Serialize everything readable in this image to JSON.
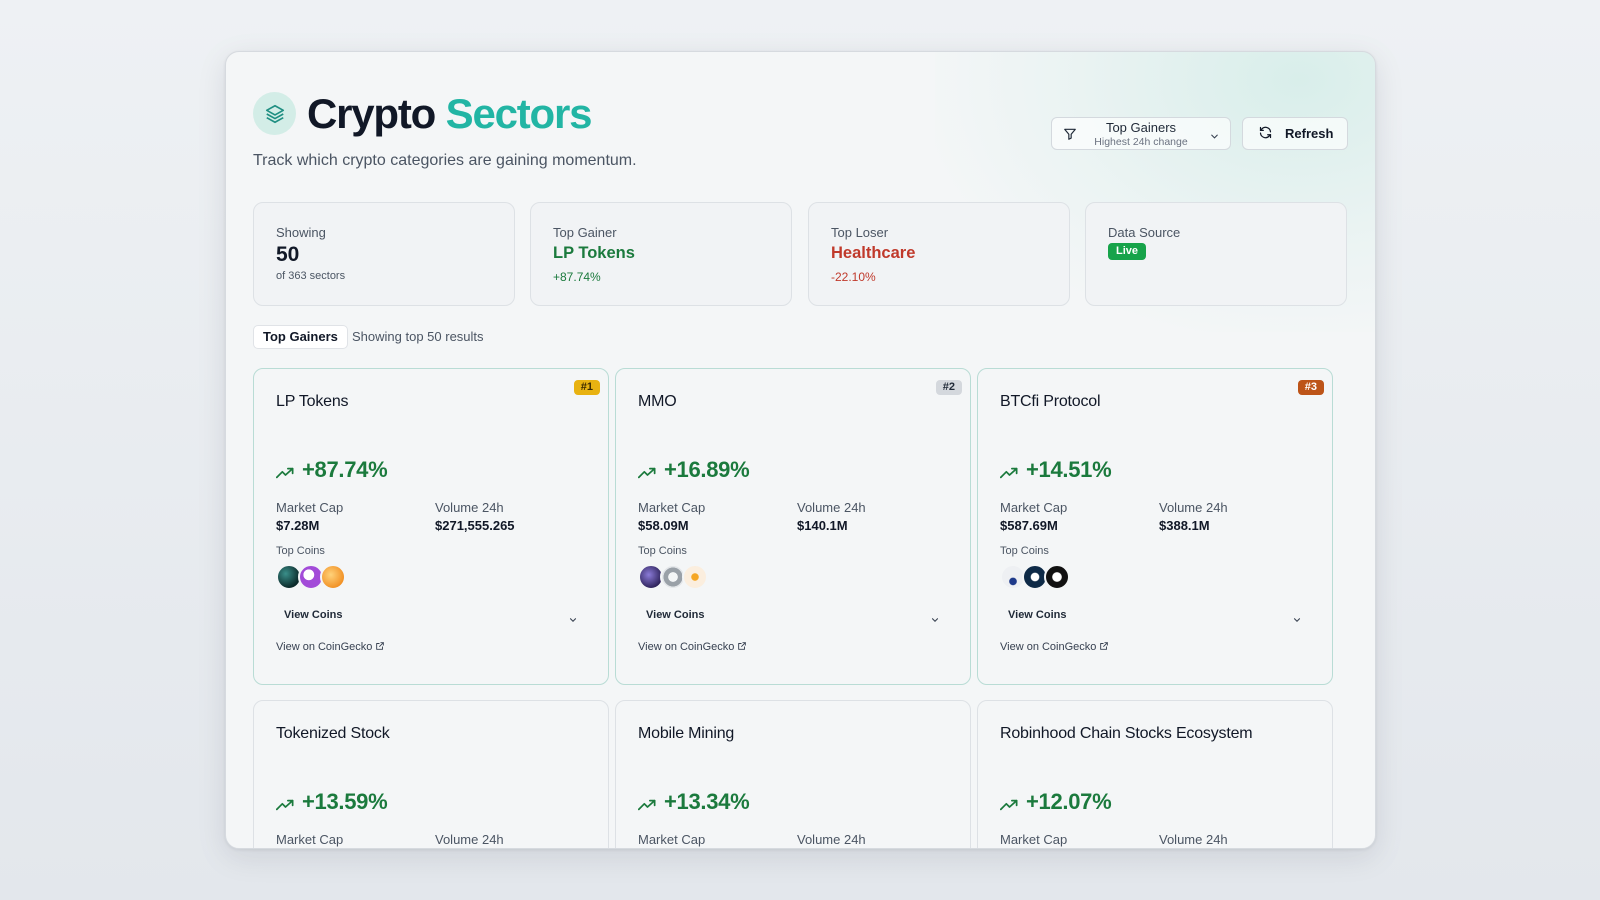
{
  "header": {
    "title_part1": "Crypto",
    "title_part2": "Sectors",
    "subtitle": "Track which crypto categories are gaining momentum.",
    "logo_icon": "layers-icon"
  },
  "controls": {
    "sort_label": "Top Gainers",
    "sort_sub": "Highest 24h change",
    "refresh_label": "Refresh"
  },
  "stats": {
    "showing": {
      "label": "Showing",
      "value": "50",
      "sub": "of 363 sectors"
    },
    "top_gainer": {
      "label": "Top Gainer",
      "name": "LP Tokens",
      "pct": "+87.74%"
    },
    "top_loser": {
      "label": "Top Loser",
      "name": "Healthcare",
      "pct": "-22.10%"
    },
    "data_source": {
      "label": "Data Source",
      "badge": "Live"
    }
  },
  "tabs": {
    "active": "Top Gainers",
    "info": "Showing top 50 results"
  },
  "labels": {
    "market_cap": "Market Cap",
    "volume": "Volume 24h",
    "top_coins": "Top Coins",
    "view_coins": "View Coins",
    "coingecko": "View on CoinGecko"
  },
  "cards": [
    {
      "name": "LP Tokens",
      "rank": "#1",
      "pct": "+87.74%",
      "market_cap": "$7.28M",
      "volume": "$271,555.265"
    },
    {
      "name": "MMO",
      "rank": "#2",
      "pct": "+16.89%",
      "market_cap": "$58.09M",
      "volume": "$140.1M"
    },
    {
      "name": "BTCfi Protocol",
      "rank": "#3",
      "pct": "+14.51%",
      "market_cap": "$587.69M",
      "volume": "$388.1M"
    },
    {
      "name": "Tokenized Stock",
      "pct": "+13.59%"
    },
    {
      "name": "Mobile Mining",
      "pct": "+13.34%"
    },
    {
      "name": "Robinhood Chain Stocks Ecosystem",
      "pct": "+12.07%"
    }
  ],
  "colors": {
    "accent": "#22b5a4",
    "gain": "#1b7a3d",
    "loss": "#c0392b",
    "live": "#17a34a",
    "rank_gold": "#e8b211",
    "rank_silver": "#d4d8dd",
    "rank_bronze": "#bd5418"
  }
}
